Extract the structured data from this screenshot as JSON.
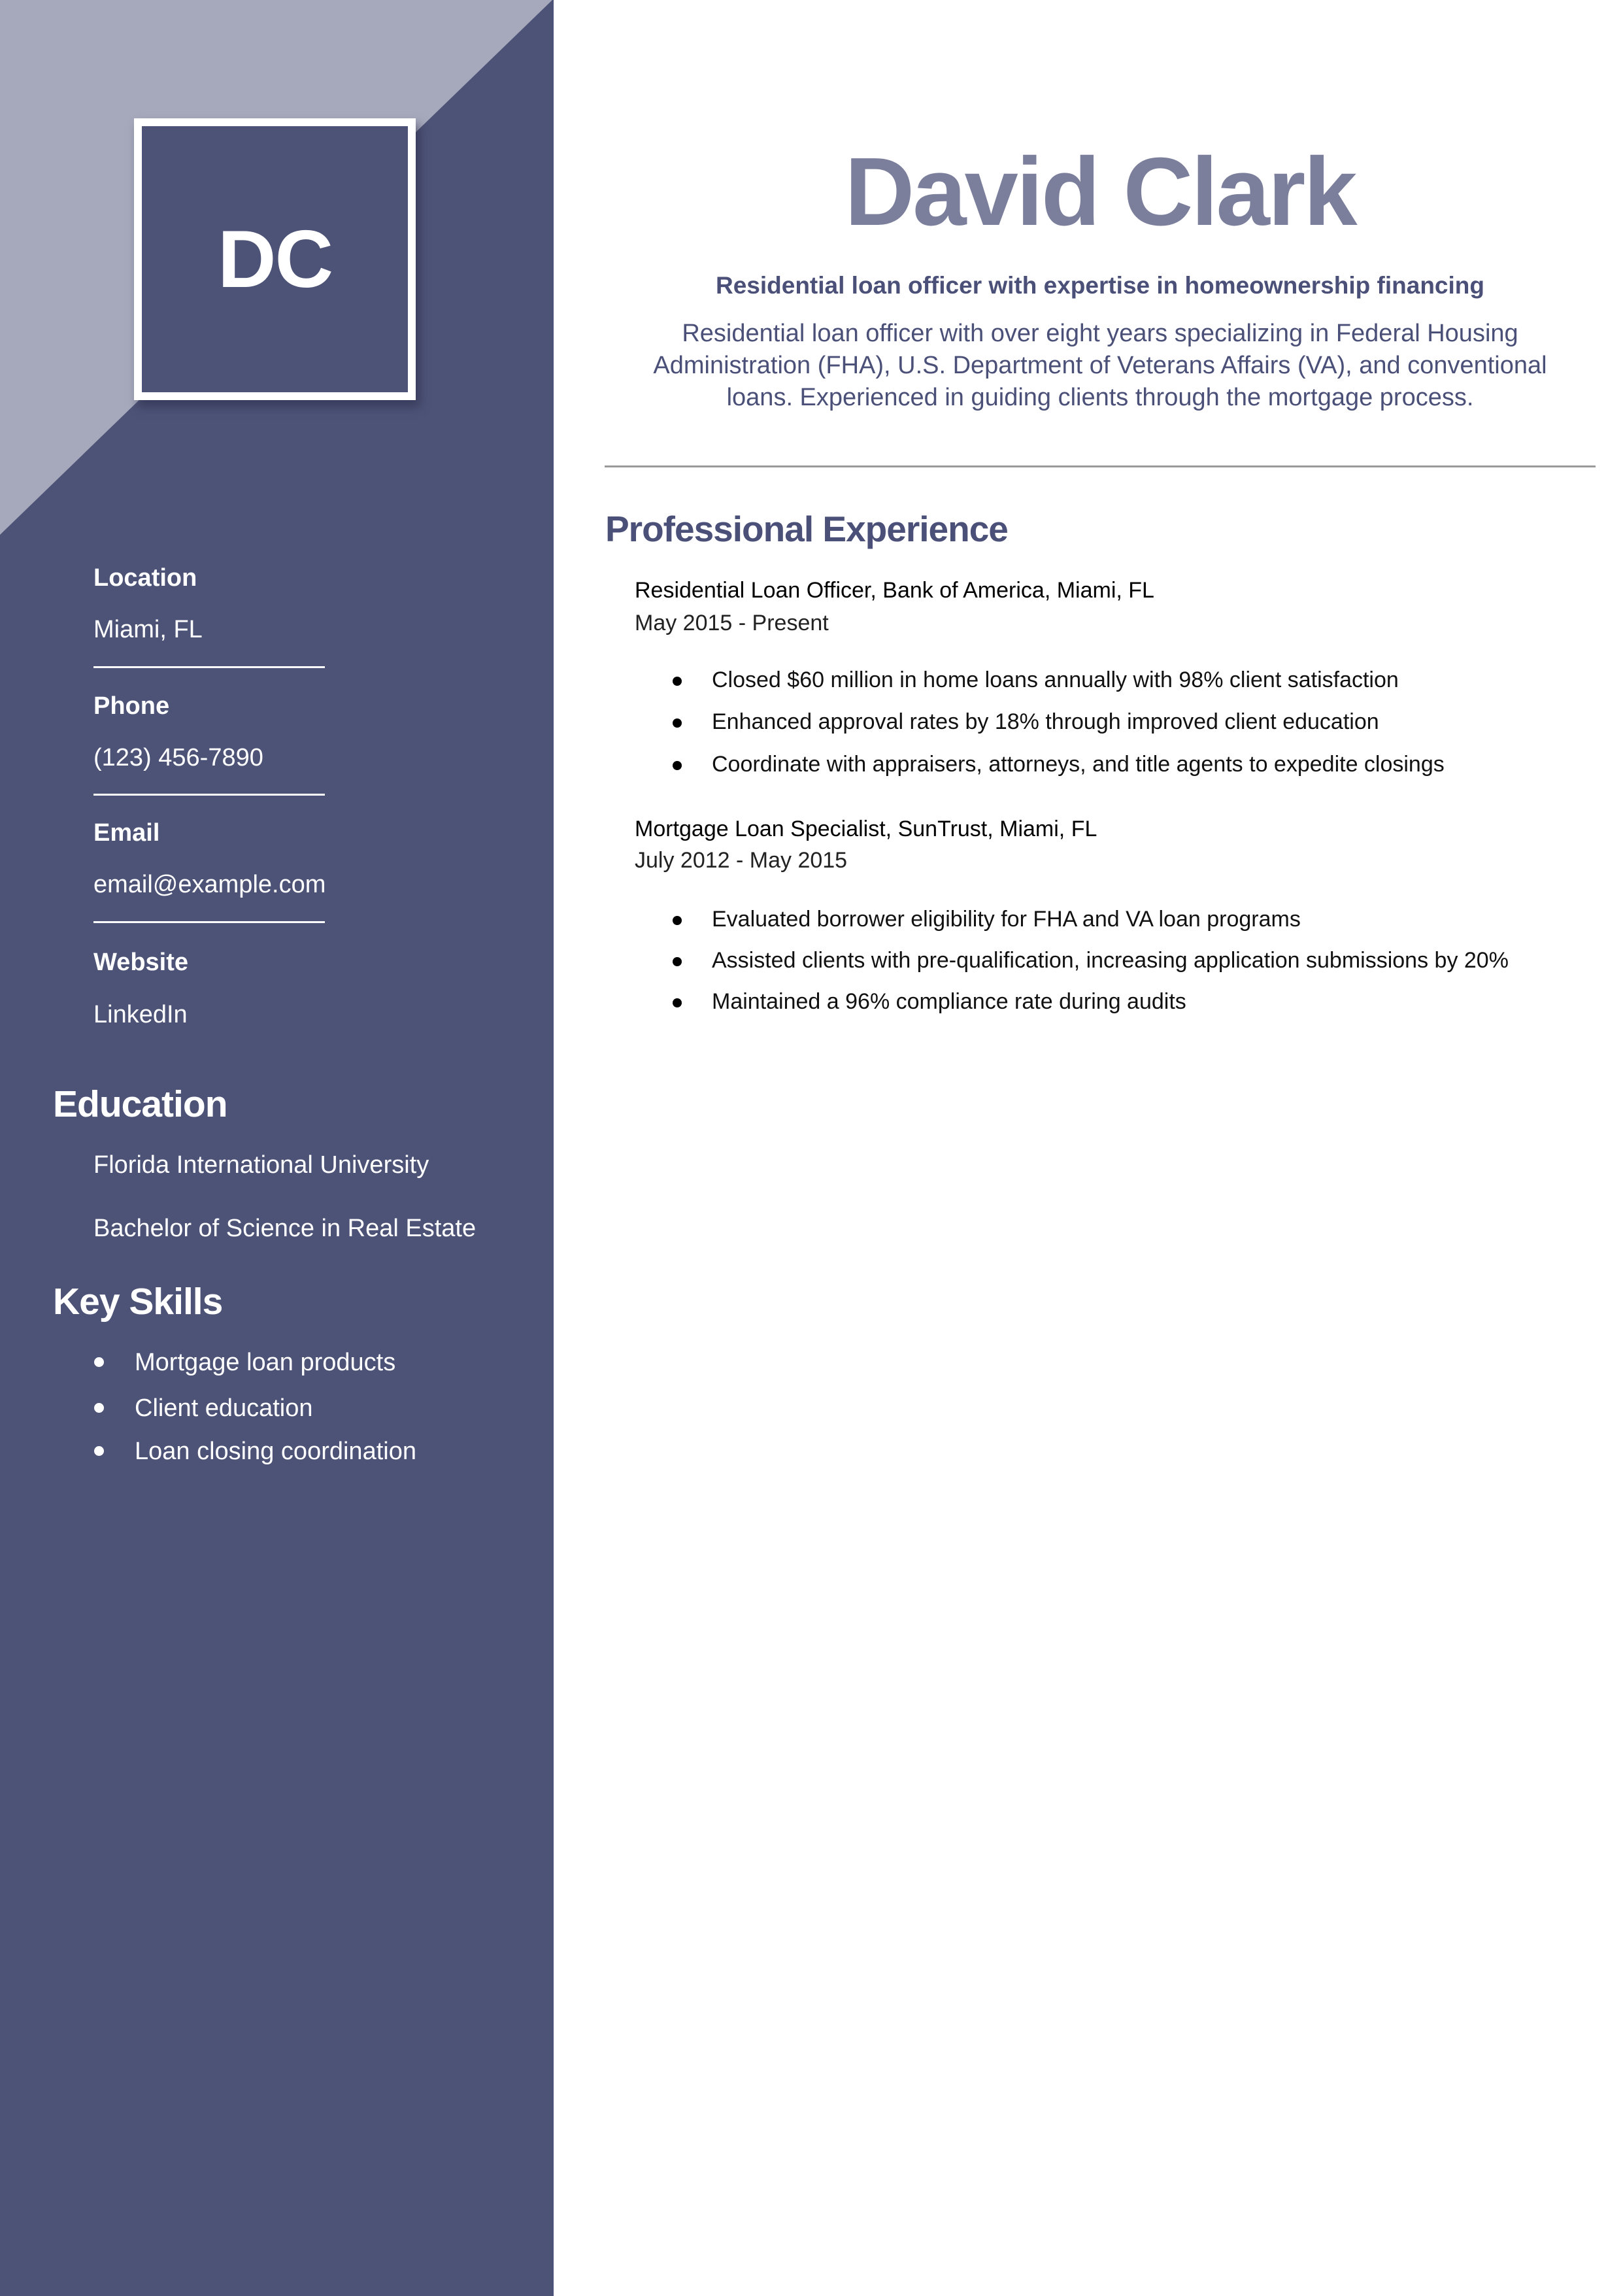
{
  "colors": {
    "sidebar": "#4d5377",
    "sidebar_corner": "#a6a9bc",
    "name": "#7b7f9c",
    "accent": "#4b5078",
    "rule": "#999999"
  },
  "monogram": "DC",
  "contact": [
    {
      "label": "Location",
      "value": "Miami, FL"
    },
    {
      "label": "Phone",
      "value": "(123) 456-7890"
    },
    {
      "label": "Email",
      "value": "email@example.com"
    },
    {
      "label": "Website",
      "value": "LinkedIn"
    }
  ],
  "education": {
    "heading": "Education",
    "school": "Florida International University",
    "degree": "Bachelor of Science in Real Estate"
  },
  "skills": {
    "heading": "Key Skills",
    "items": [
      "Mortgage loan products",
      "Client education",
      "Loan closing coordination"
    ]
  },
  "header": {
    "name": "David Clark",
    "tagline": "Residential loan officer with expertise in homeownership financing",
    "summary_lines": [
      "Residential loan officer with over eight years specializing in Federal Housing",
      "Administration (FHA), U.S. Department of Veterans Affairs (VA), and conventional",
      "loans. Experienced in guiding clients through the mortgage process."
    ]
  },
  "experience": {
    "heading": "Professional Experience",
    "jobs": [
      {
        "title": "Residential Loan Officer, Bank of America, Miami, FL",
        "dates": "May 2015 - Present",
        "bullets": [
          "Closed $60 million in home loans annually with 98% client satisfaction",
          "Enhanced approval rates by 18% through improved client education",
          "Coordinate with appraisers, attorneys, and title agents to expedite closings"
        ]
      },
      {
        "title": "Mortgage Loan Specialist, SunTrust, Miami, FL",
        "dates": "July 2012 - May 2015",
        "bullets": [
          "Evaluated borrower eligibility for FHA and VA loan programs",
          "Assisted clients with pre-qualification, increasing application submissions by 20%",
          "Maintained a 96% compliance rate during audits"
        ]
      }
    ]
  }
}
